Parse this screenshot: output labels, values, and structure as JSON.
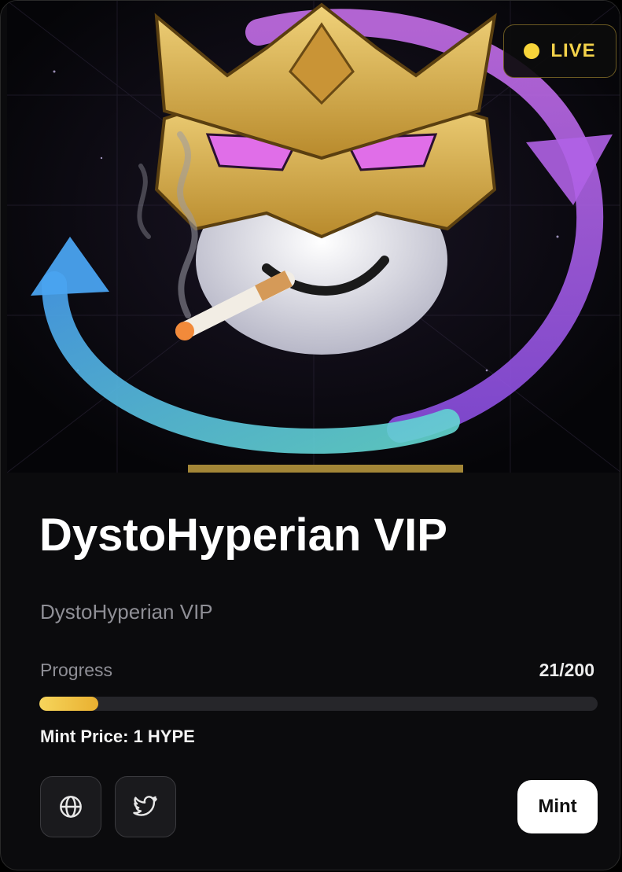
{
  "collection": {
    "title": "DystoHyperian VIP",
    "subtitle": "DystoHyperian VIP",
    "status_badge": "LIVE",
    "progress_label": "Progress",
    "progress_count": "21/200",
    "progress_fraction": 0.105,
    "mint_price_label": "Mint Price: 1 HYPE"
  },
  "actions": {
    "website_icon": "globe-icon",
    "twitter_icon": "twitter-icon",
    "mint_label": "Mint"
  },
  "colors": {
    "accent": "#f3d24a",
    "progress_fill": "#f0c447",
    "card_background": "#0b0b0d"
  },
  "hero_image": {
    "description_icon": "masked-face-artwork"
  }
}
